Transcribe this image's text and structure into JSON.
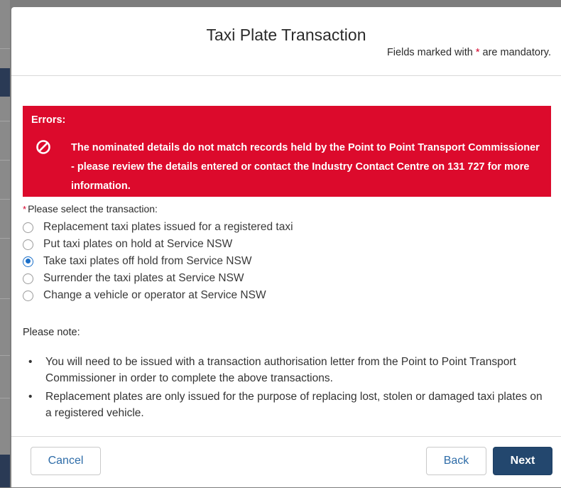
{
  "modal": {
    "title": "Taxi Plate Transaction",
    "mandatory_prefix": "Fields marked with ",
    "mandatory_star": "*",
    "mandatory_suffix": " are mandatory."
  },
  "error": {
    "heading": "Errors:",
    "icon": "no-entry-icon",
    "message": "The nominated details do not match records held by the Point to Point Transport Commissioner - please review the details entered or contact the Industry Contact Centre on 131 727 for more information.",
    "background_color": "#dc0a2c"
  },
  "transaction": {
    "required_star": "*",
    "label": "Please select the transaction:",
    "options": [
      {
        "label": "Replacement taxi plates issued for a registered taxi",
        "selected": false
      },
      {
        "label": "Put taxi plates on hold at Service NSW",
        "selected": false
      },
      {
        "label": "Take taxi plates off hold from Service NSW",
        "selected": true
      },
      {
        "label": "Surrender the taxi plates at Service NSW",
        "selected": false
      },
      {
        "label": "Change a vehicle or operator at Service NSW",
        "selected": false
      }
    ]
  },
  "notes": {
    "title": "Please note:",
    "items": [
      "You will need to be issued with a transaction authorisation letter from the Point to Point Transport Commissioner in order to complete the above transactions.",
      "Replacement plates are only issued for the purpose of replacing lost, stolen or damaged taxi plates on a registered vehicle."
    ]
  },
  "footer": {
    "cancel_label": "Cancel",
    "back_label": "Back",
    "next_label": "Next"
  },
  "colors": {
    "accent": "#1a6fc9",
    "primary_button": "#23476e",
    "required": "#d4002a"
  }
}
